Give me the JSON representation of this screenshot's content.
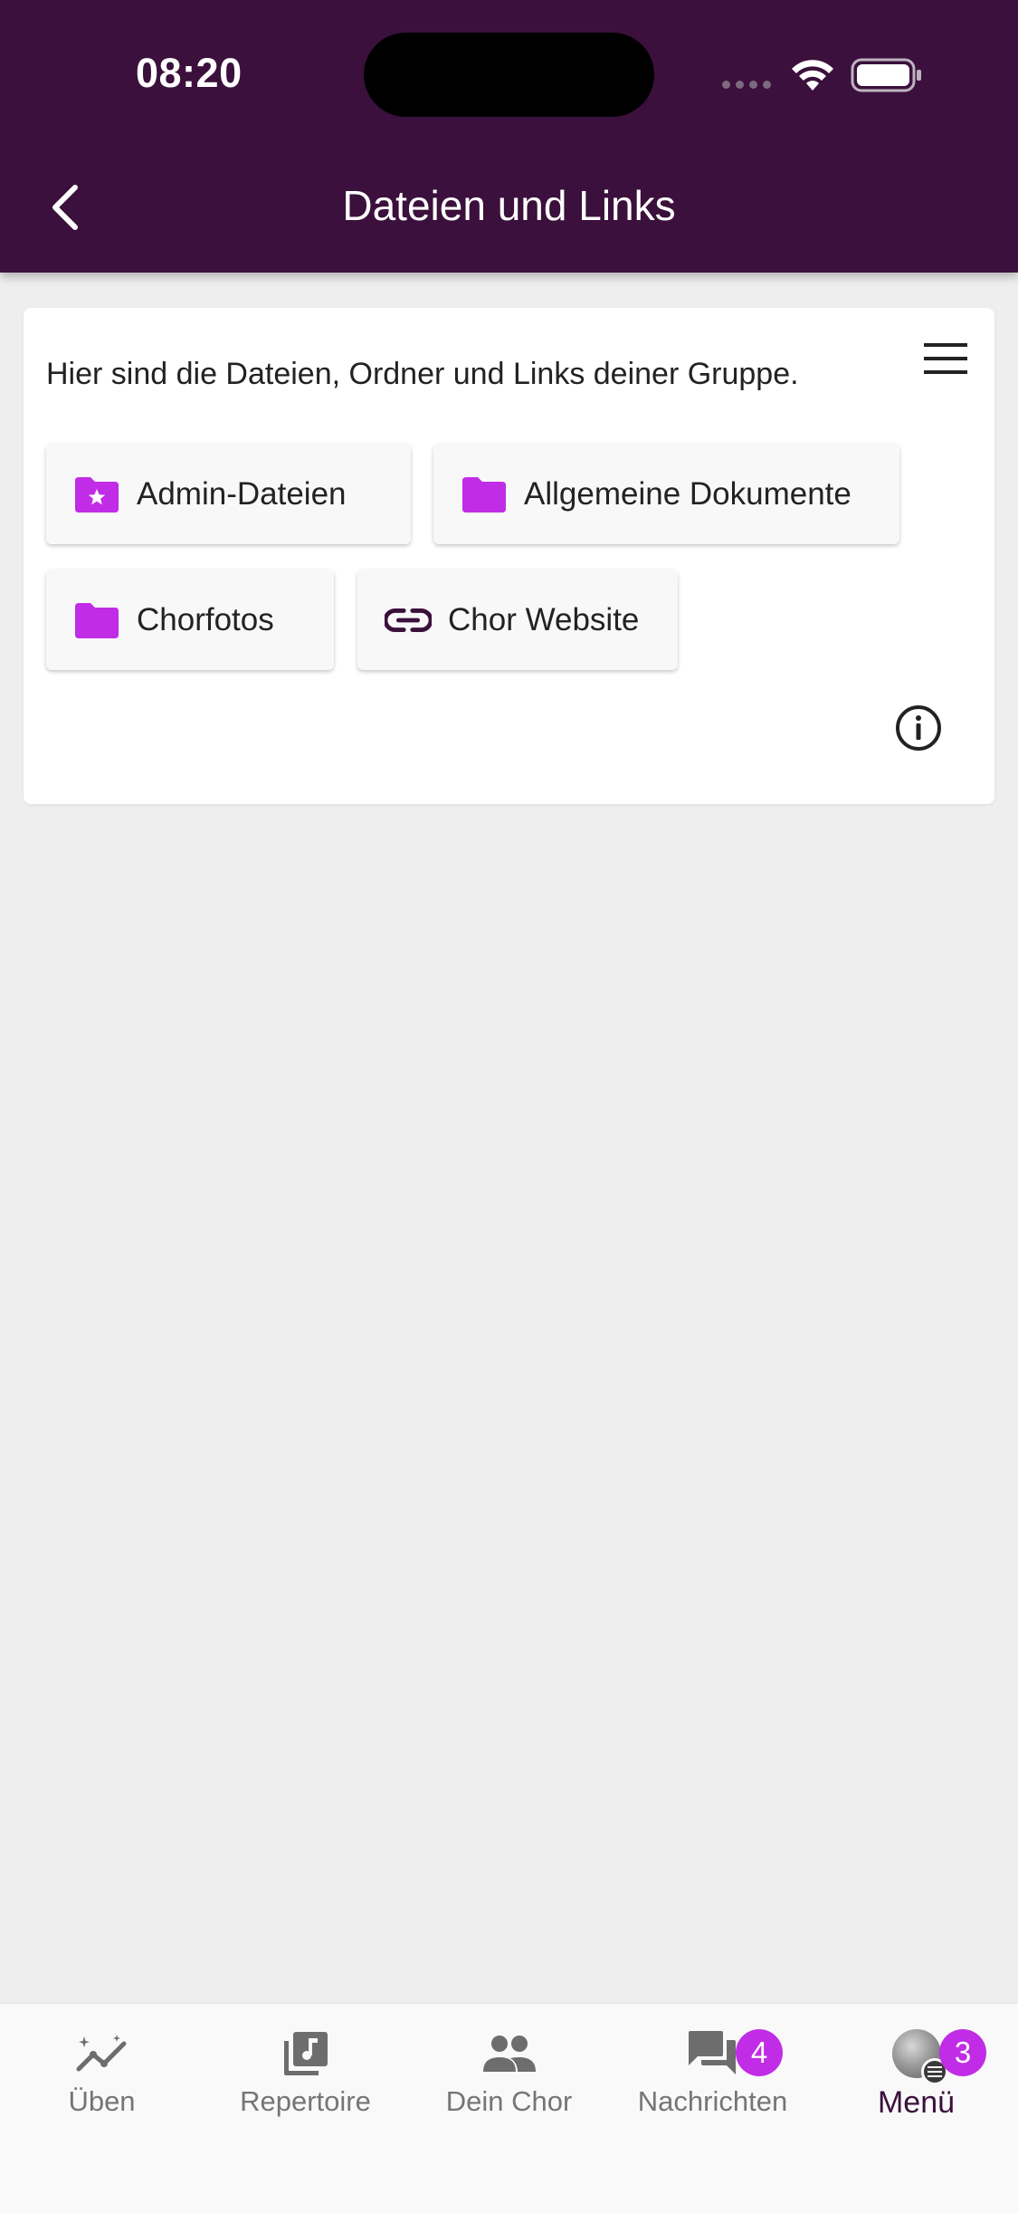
{
  "status_bar": {
    "time": "08:20"
  },
  "app_bar": {
    "title": "Dateien und Links"
  },
  "card": {
    "intro": "Hier sind die Dateien, Ordner und Links deiner Gruppe.",
    "items": [
      {
        "label": "Admin-Dateien",
        "icon": "starred-folder-icon"
      },
      {
        "label": "Allgemeine Dokumente",
        "icon": "folder-icon"
      },
      {
        "label": "Chorfotos",
        "icon": "folder-icon"
      },
      {
        "label": "Chor Website",
        "icon": "link-icon"
      }
    ]
  },
  "bottom_nav": {
    "items": [
      {
        "label": "Üben",
        "icon": "trending-chart-icon"
      },
      {
        "label": "Repertoire",
        "icon": "music-library-icon"
      },
      {
        "label": "Dein Chor",
        "icon": "group-icon"
      },
      {
        "label": "Nachrichten",
        "icon": "chat-icon",
        "badge": "4"
      },
      {
        "label": "Menü",
        "icon": "avatar",
        "badge": "3",
        "active": true
      }
    ]
  },
  "colors": {
    "header_bg": "#3b103c",
    "accent_purple": "#c12ce6",
    "background": "#eeeeee",
    "card_bg": "#ffffff"
  }
}
